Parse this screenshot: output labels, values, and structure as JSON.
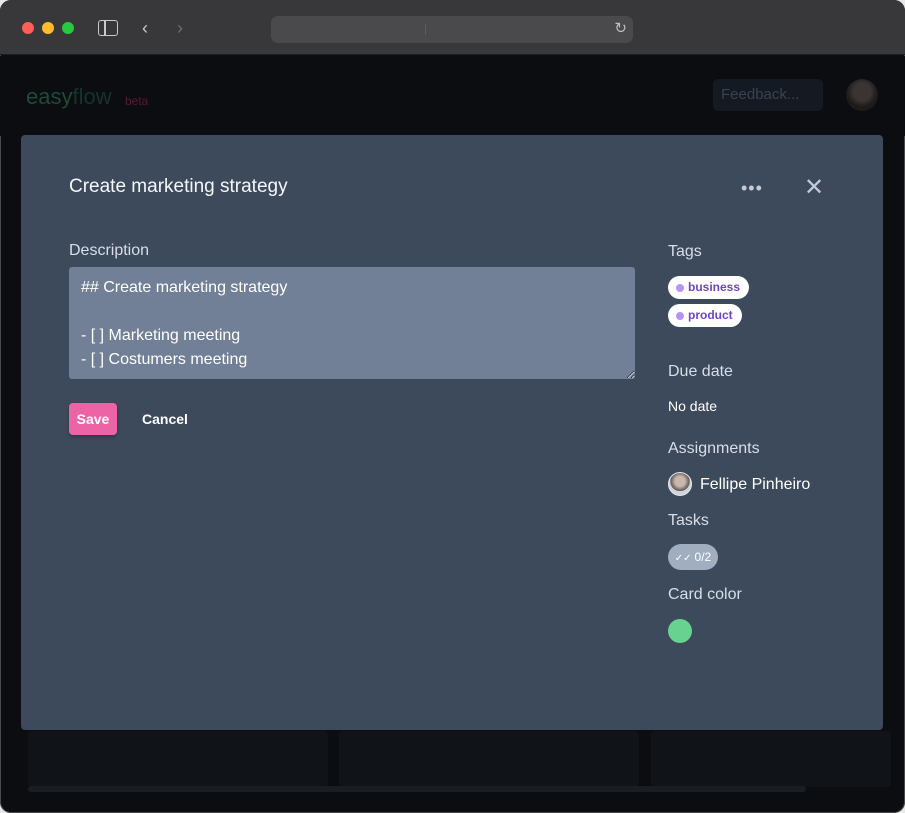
{
  "browser": {
    "reload_glyph": "↻",
    "back_glyph": "‹",
    "forward_glyph": "›"
  },
  "app": {
    "logo_part1": "easy",
    "logo_part2": "flow",
    "beta": "beta",
    "feedback": "Feedback..."
  },
  "modal": {
    "title": "Create marketing strategy",
    "more_glyph": "•••",
    "close_glyph": "✕",
    "description_label": "Description",
    "description_value": "## Create marketing strategy\n\n- [ ] Marketing meeting\n- [ ] Costumers meeting",
    "save_label": "Save",
    "cancel_label": "Cancel",
    "tags_label": "Tags",
    "tags": [
      {
        "label": "business"
      },
      {
        "label": "product"
      }
    ],
    "due_date_label": "Due date",
    "due_date_value": "No date",
    "assignments_label": "Assignments",
    "assignee_name": "Fellipe Pinheiro",
    "tasks_label": "Tasks",
    "tasks_check_glyph": "✓✓",
    "tasks_progress": "0/2",
    "card_color_label": "Card color",
    "card_color": "#68d391"
  },
  "colors": {
    "modal_bg": "#3d4a5c",
    "save_button": "#ed64a6",
    "tag_text": "#6b46c1",
    "tag_dot": "#b794f4",
    "description_bg": "#718096"
  }
}
